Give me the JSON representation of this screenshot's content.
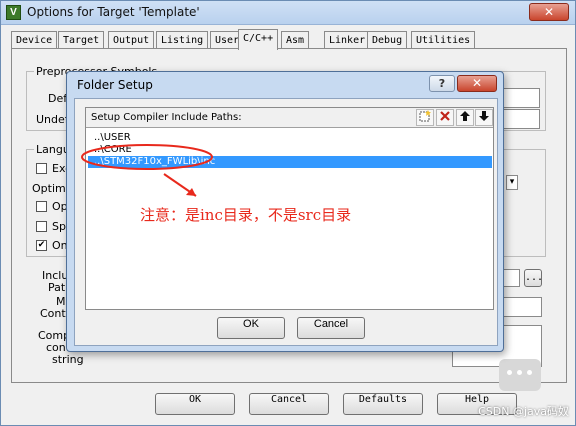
{
  "window": {
    "title": "Options for Target 'Template'",
    "icon": "V",
    "close_glyph": "✕"
  },
  "tabs": [
    "Device",
    "Target",
    "Output",
    "Listing",
    "User",
    "C/C++",
    "Asm",
    "Linker",
    "Debug",
    "Utilities"
  ],
  "active_tab": "C/C++",
  "background_form": {
    "preprocessor_group": "Preprocessor Symbols",
    "define_label": "Defin",
    "undefine_label": "Undefin",
    "language_group": "Languag",
    "exec_label": "Exec",
    "optimiz_label": "Optimiz",
    "optin_label": "Optin",
    "split_label": "Split",
    "one_label": "One",
    "one_checked": true,
    "include_labels": [
      "Include",
      "Paths",
      "Misc",
      "Controls",
      "Compile",
      "control",
      "string"
    ],
    "browse_label": "...",
    "combo_arrow": "▾"
  },
  "footer_buttons": {
    "ok": "OK",
    "cancel": "Cancel",
    "defaults": "Defaults",
    "help": "Help"
  },
  "watermark": "CSDN @java码奴",
  "dialog": {
    "title": "Folder Setup",
    "help_glyph": "?",
    "close_glyph": "✕",
    "list_header": "Setup Compiler Include Paths:",
    "toolbar": {
      "new_icon": "new-folder-icon",
      "delete_icon": "delete-icon",
      "up_icon": "move-up-icon",
      "down_icon": "move-down-icon"
    },
    "paths": [
      "..\\USER",
      "..\\CORE",
      "..\\STM32F10x_FWLib\\inc"
    ],
    "selected_index": 2,
    "ok": "OK",
    "cancel": "Cancel"
  },
  "annotation": {
    "text": "注意：是inc目录，不是src目录",
    "color": "#e8291c"
  }
}
